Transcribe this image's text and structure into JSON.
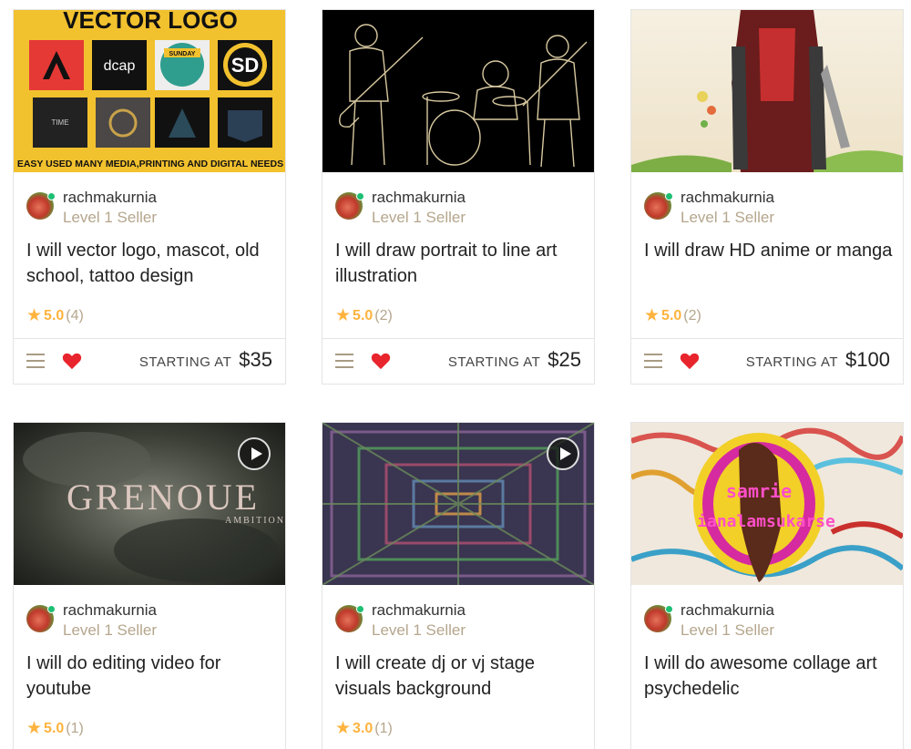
{
  "gigs": [
    {
      "thumb_heading": "VECTOR LOGO",
      "thumb_logos": [
        "dcap",
        "SUNDAY",
        "SD",
        "TIME"
      ],
      "thumb_footer": "EASY USED MANY MEDIA,PRINTING AND DIGITAL NEEDS",
      "seller": "rachmakurnia",
      "level": "Level 1 Seller",
      "title": "I will vector logo, mascot, old school, tattoo design",
      "score": "5.0",
      "count": "(4)",
      "starting_label": "STARTING AT",
      "price": "$35"
    },
    {
      "seller": "rachmakurnia",
      "level": "Level 1 Seller",
      "title": "I will draw portrait to line art illustration",
      "score": "5.0",
      "count": "(2)",
      "starting_label": "STARTING AT",
      "price": "$25"
    },
    {
      "seller": "rachmakurnia",
      "level": "Level 1 Seller",
      "title": "I will draw HD anime or manga",
      "score": "5.0",
      "count": "(2)",
      "starting_label": "STARTING AT",
      "price": "$100"
    },
    {
      "thumb_heading": "GRENOUE",
      "thumb_sub": "AMBITION",
      "seller": "rachmakurnia",
      "level": "Level 1 Seller",
      "title": "I will do editing video for youtube",
      "score": "5.0",
      "count": "(1)"
    },
    {
      "seller": "rachmakurnia",
      "level": "Level 1 Seller",
      "title": "I will create dj or vj stage visuals background",
      "score": "3.0",
      "count": "(1)"
    },
    {
      "thumb_heading": "samrie",
      "thumb_sub": "ianalamsukarse",
      "seller": "rachmakurnia",
      "level": "Level 1 Seller",
      "title": "I will do awesome collage art psychedelic"
    }
  ],
  "colors": {
    "star": "#ffb33e",
    "level": "#b5a68d",
    "heart": "#e8242c",
    "online": "#1dbf73"
  }
}
